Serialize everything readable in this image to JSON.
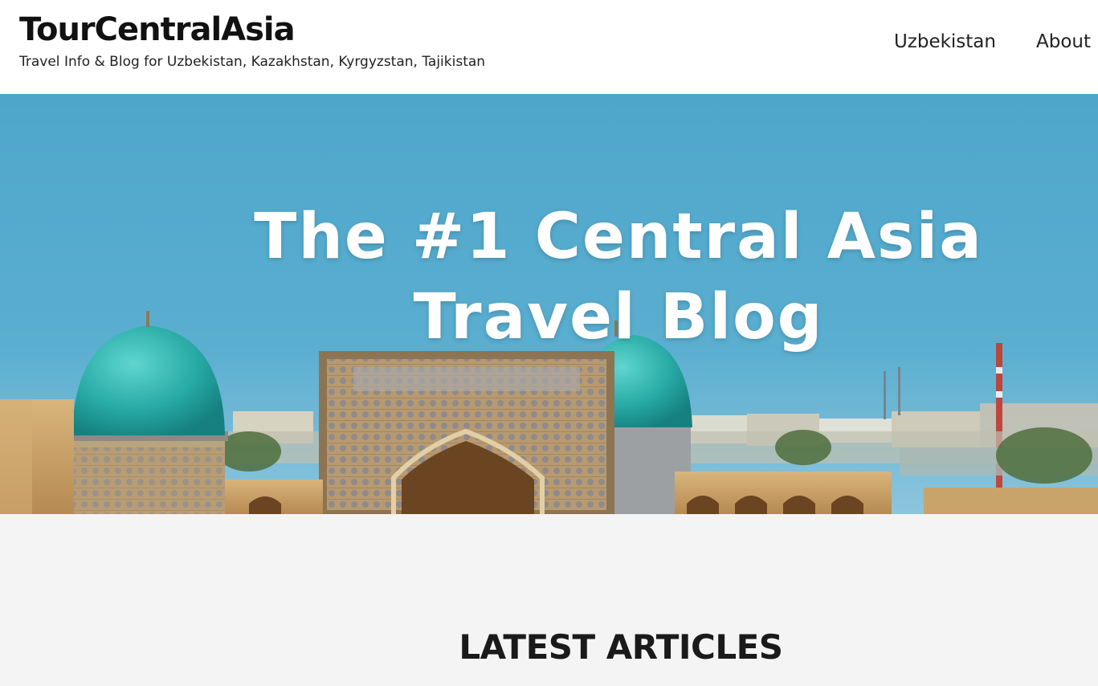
{
  "header": {
    "site_title": "TourCentralAsia",
    "tagline": "Travel Info & Blog for Uzbekistan, Kazakhstan, Kyrgyzstan, Tajikistan",
    "nav": [
      {
        "label": "Uzbekistan"
      },
      {
        "label": "About"
      }
    ]
  },
  "hero": {
    "title_line1": "The #1 Central Asia",
    "title_line2": "Travel Blog"
  },
  "latest": {
    "heading": "LATEST ARTICLES"
  },
  "colors": {
    "sky": "#4aa6c9",
    "dome_turquoise": "#2fb3ad",
    "sandstone": "#c9a46a",
    "section_bg": "#f4f4f4",
    "text_dark": "#111111"
  }
}
